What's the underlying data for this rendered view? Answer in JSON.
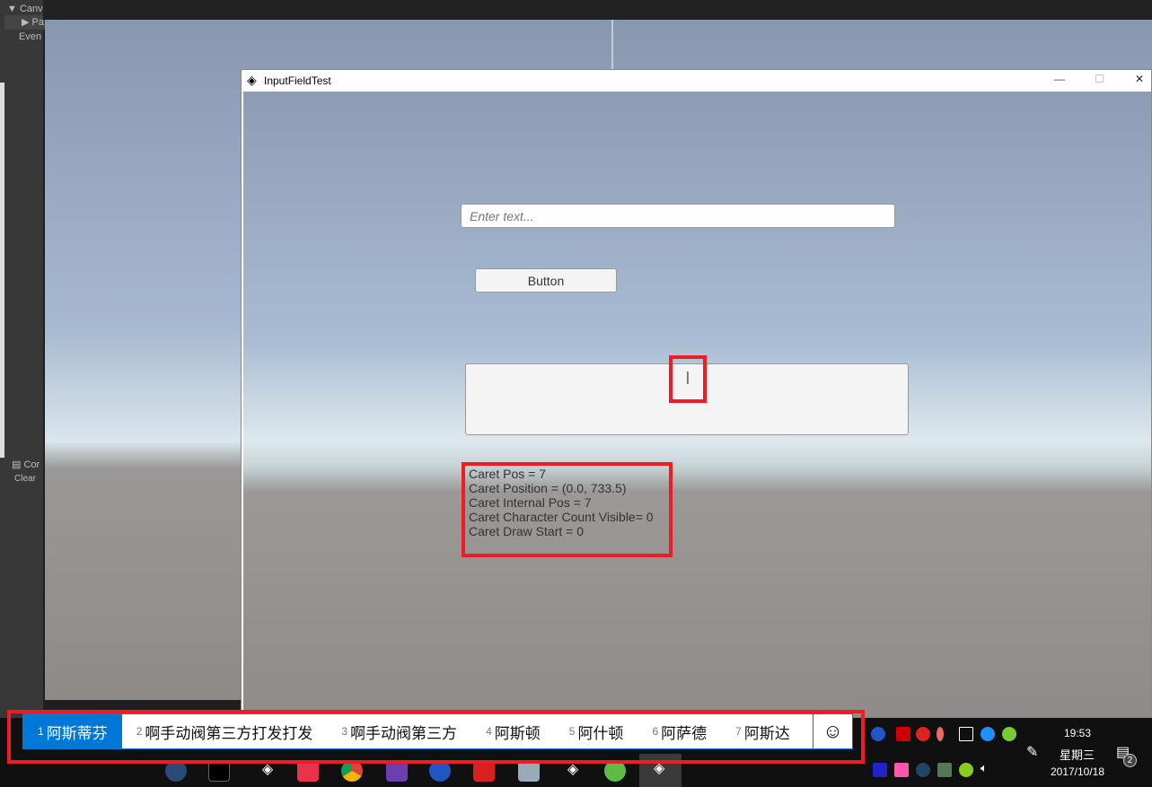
{
  "hierarchy": {
    "items": [
      "Canv",
      "Pa",
      "Even"
    ]
  },
  "console": {
    "tab": "Cor",
    "clear": "Clear"
  },
  "game_window": {
    "title": "InputFieldTest",
    "controls": {
      "minimize": "—",
      "maximize": "☐",
      "close": "✕"
    }
  },
  "input_field": {
    "placeholder": "Enter text...",
    "value": ""
  },
  "button": {
    "label": "Button"
  },
  "text_area": {
    "caret": "|"
  },
  "info": {
    "lines": [
      "Caret Pos = 7",
      "Caret Position = (0.0, 733.5)",
      "Caret Internal Pos = 7",
      "Caret Character Count Visible= 0",
      "Caret Draw Start = 0"
    ]
  },
  "ime": {
    "candidates": [
      {
        "n": "1",
        "text": "阿斯蒂芬"
      },
      {
        "n": "2",
        "text": "啊手动阀第三方打发打发"
      },
      {
        "n": "3",
        "text": "啊手动阀第三方"
      },
      {
        "n": "4",
        "text": "阿斯顿"
      },
      {
        "n": "5",
        "text": "阿什顿"
      },
      {
        "n": "6",
        "text": "阿萨德"
      },
      {
        "n": "7",
        "text": "阿斯达"
      }
    ],
    "emoji": "☺"
  },
  "tray": {
    "time": "19:53",
    "weekday": "星期三",
    "date": "2017/10/18",
    "notifications": "2"
  },
  "colors": {
    "highlight": "#ee1c25",
    "ime_accent": "#0078d7"
  }
}
